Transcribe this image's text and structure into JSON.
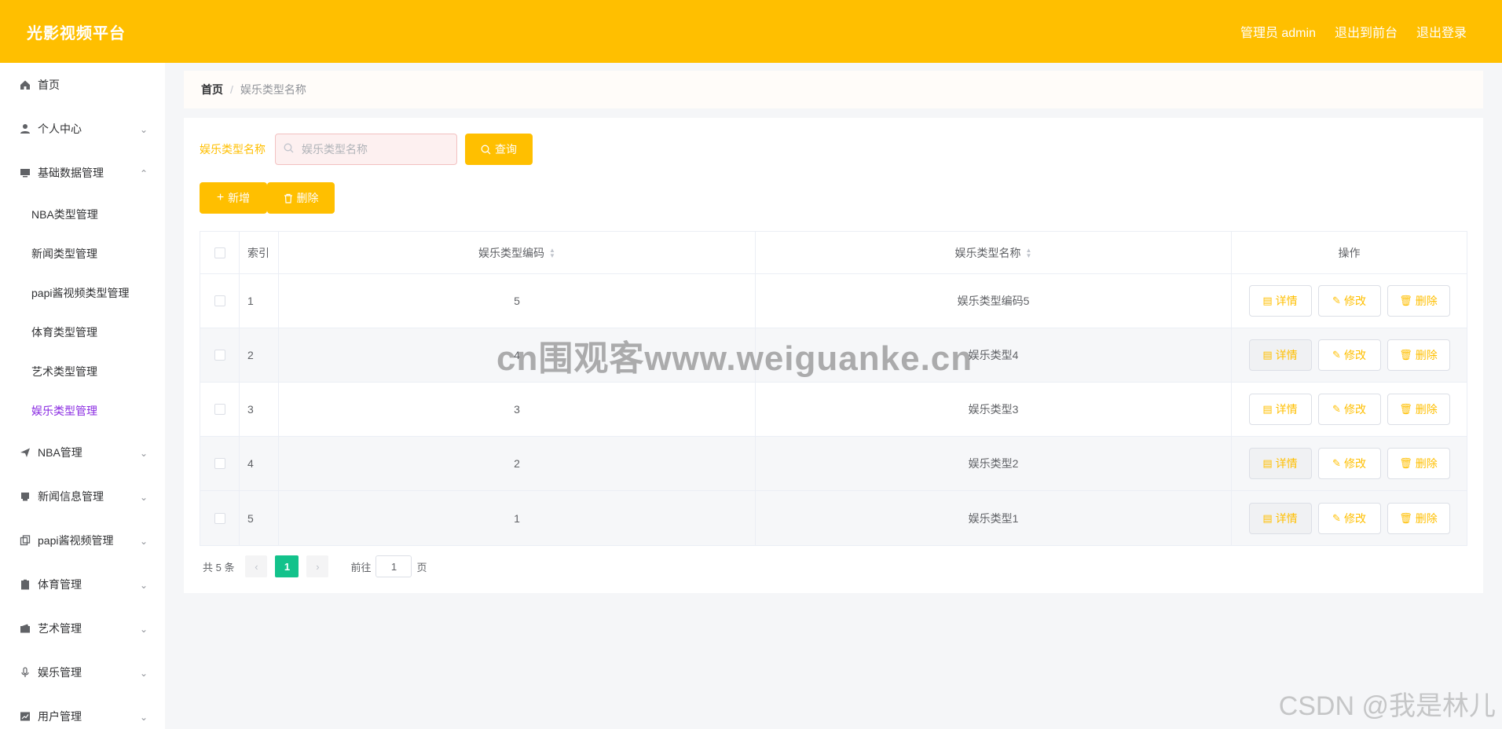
{
  "header": {
    "brand": "光影视频平台",
    "admin": "管理员 admin",
    "to_front": "退出到前台",
    "logout": "退出登录"
  },
  "sidebar": {
    "home": "首页",
    "personal": "个人中心",
    "basic": "基础数据管理",
    "basic_items": [
      "NBA类型管理",
      "新闻类型管理",
      "papi酱视频类型管理",
      "体育类型管理",
      "艺术类型管理",
      "娱乐类型管理"
    ],
    "nba": "NBA管理",
    "news": "新闻信息管理",
    "papi": "papi酱视频管理",
    "sports": "体育管理",
    "art": "艺术管理",
    "ent": "娱乐管理",
    "user": "用户管理"
  },
  "breadcrumb": {
    "home": "首页",
    "sep": "/",
    "current": "娱乐类型名称"
  },
  "search": {
    "label": "娱乐类型名称",
    "placeholder": "娱乐类型名称",
    "query": "查询"
  },
  "actions": {
    "add": "新增",
    "delete": "删除"
  },
  "table": {
    "headers": {
      "index": "索引",
      "code": "娱乐类型编码",
      "name": "娱乐类型名称",
      "op": "操作"
    },
    "op_labels": {
      "detail": "详情",
      "edit": "修改",
      "delete": "删除"
    },
    "rows": [
      {
        "index": "1",
        "code": "5",
        "name": "娱乐类型编码5"
      },
      {
        "index": "2",
        "code": "4",
        "name": "娱乐类型4"
      },
      {
        "index": "3",
        "code": "3",
        "name": "娱乐类型3"
      },
      {
        "index": "4",
        "code": "2",
        "name": "娱乐类型2"
      },
      {
        "index": "5",
        "code": "1",
        "name": "娱乐类型1"
      }
    ]
  },
  "pagination": {
    "total": "共 5 条",
    "current": "1",
    "goto": "前往",
    "goto_value": "1",
    "page_unit": "页"
  },
  "watermarks": {
    "center": "cn围观客www.weiguanke.cn",
    "corner": "CSDN @我是林儿"
  },
  "colors": {
    "accent": "#ffbf00",
    "active_menu": "#8a2be2",
    "pager_active": "#13c28b"
  }
}
